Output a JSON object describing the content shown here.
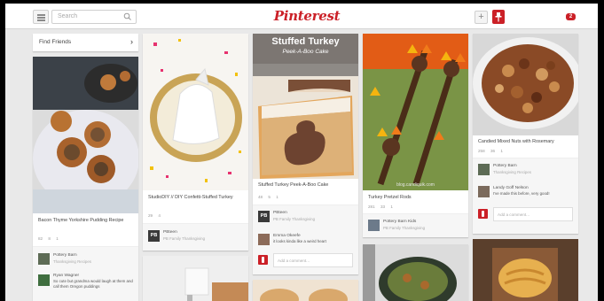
{
  "header": {
    "search_placeholder": "Search",
    "logo": "Pinterest",
    "notifications": "2"
  },
  "sidebar": {
    "find_friends": "Find Friends"
  },
  "pins": [
    {
      "desc": "Bacon Thyme Yorkshire Pudding Recipe",
      "repins": "82",
      "likes": "8",
      "comments": "1",
      "pinner": {
        "name": "Pottery Barn",
        "board": "Thanksgiving Recipes"
      },
      "comment": {
        "name": "Ryan Wagner",
        "text": "So cute but grandma would laugh at them and call them Oregon puddings"
      }
    },
    {
      "desc": "StudioDIY // DIY Confetti-Stuffed Turkey",
      "repins": "29",
      "likes": "4",
      "pinner": {
        "initials": "PB",
        "name": "PBteen",
        "board": "PB Family Thanksgiving"
      }
    },
    {
      "title": "Stuffed Turkey",
      "subtitle": "Peek-A-Boo Cake",
      "desc": "Stuffed Turkey Peek-A-Boo Cake",
      "repins": "48",
      "likes": "5",
      "comments": "1",
      "pinner": {
        "initials": "PB",
        "name": "PBteen",
        "board": "PB Family Thanksgiving"
      },
      "comment": {
        "name": "Emma Okeefe",
        "text": "it looks kinda like a weird heart"
      },
      "add_comment": "Add a comment..."
    },
    {
      "desc": "Turkey Pretzel Rods",
      "watermark": "blog.candiquik.com",
      "repins": "281",
      "likes": "33",
      "comments": "1",
      "pinner": {
        "name": "Pottery Barn Kids",
        "board": "PB Family Thanksgiving"
      }
    },
    {
      "desc": "Candied Mixed Nuts with Rosemary",
      "repins": "258",
      "likes": "36",
      "comments": "1",
      "pinner": {
        "name": "Pottery Barn",
        "board": "Thanksgiving Recipes"
      },
      "comment": {
        "name": "Landy Goff Nelson",
        "text": "I've made this before, very good!"
      },
      "add_comment": "Add a comment..."
    }
  ],
  "colors": {
    "brand": "#cb2027",
    "background": "#e9e9e9",
    "card": "#ffffff"
  }
}
